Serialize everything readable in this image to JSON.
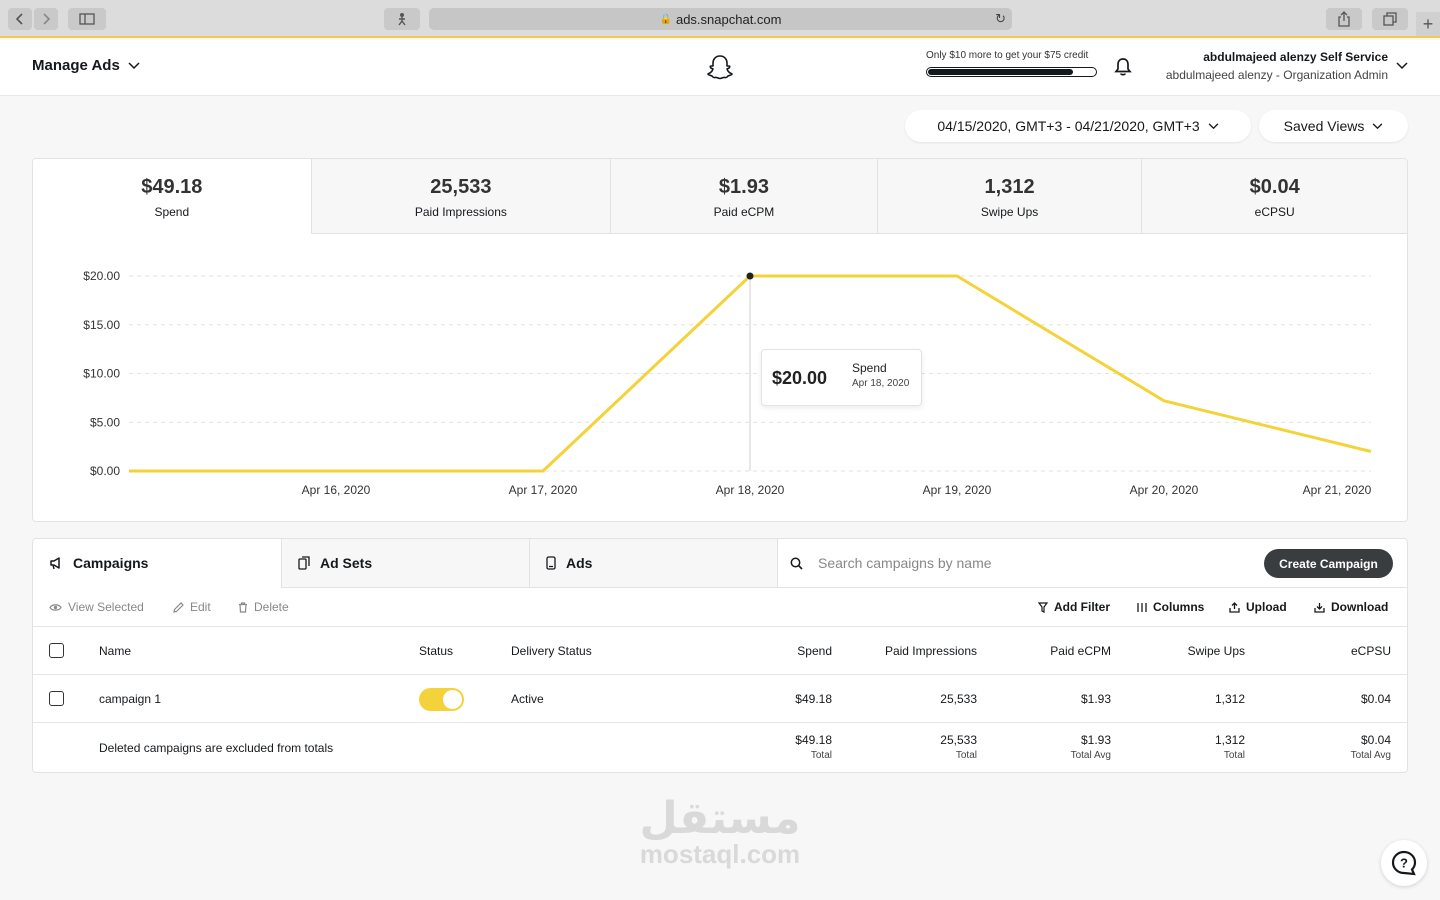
{
  "browser": {
    "url": "ads.snapchat.com",
    "back_icon": "chevron-left-icon",
    "forward_icon": "chevron-right-icon"
  },
  "header": {
    "menu_label": "Manage Ads",
    "credit_text": "Only $10 more to get your $75 credit",
    "credit_progress": 0.87,
    "account_name": "abdulmajeed alenzy Self Service",
    "account_role": "abdulmajeed alenzy - Organization Admin"
  },
  "filters": {
    "date_range": "04/15/2020, GMT+3 - 04/21/2020, GMT+3",
    "saved_views": "Saved Views"
  },
  "metrics": [
    {
      "value": "$49.18",
      "label": "Spend"
    },
    {
      "value": "25,533",
      "label": "Paid Impressions"
    },
    {
      "value": "$1.93",
      "label": "Paid eCPM"
    },
    {
      "value": "1,312",
      "label": "Swipe Ups"
    },
    {
      "value": "$0.04",
      "label": "eCPSU"
    }
  ],
  "tooltip": {
    "value": "$20.00",
    "label": "Spend",
    "date": "Apr 18, 2020"
  },
  "chart_data": {
    "type": "line",
    "x": [
      "Apr 15, 2020",
      "Apr 16, 2020",
      "Apr 17, 2020",
      "Apr 18, 2020",
      "Apr 19, 2020",
      "Apr 20, 2020",
      "Apr 21, 2020"
    ],
    "x_tick_labels": [
      "Apr 16, 2020",
      "Apr 17, 2020",
      "Apr 18, 2020",
      "Apr 19, 2020",
      "Apr 20, 2020",
      "Apr 21, 2020"
    ],
    "series": [
      {
        "values": [
          0,
          0,
          0,
          20.0,
          20.0,
          7.2,
          2.0
        ],
        "color": "#f4d23a"
      }
    ],
    "ylim": [
      0,
      20
    ],
    "y_ticks": [
      0,
      5,
      10,
      15,
      20
    ],
    "y_tick_labels": [
      "$0.00",
      "$5.00",
      "$10.00",
      "$15.00",
      "$20.00"
    ],
    "grid": true,
    "highlighted_point": "Apr 18, 2020"
  },
  "campaigns": {
    "tabs": [
      {
        "label": "Campaigns",
        "icon": "megaphone-icon"
      },
      {
        "label": "Ad Sets",
        "icon": "ad-sets-icon"
      },
      {
        "label": "Ads",
        "icon": "ad-icon"
      }
    ],
    "search_placeholder": "Search campaigns by name",
    "create_label": "Create Campaign",
    "toolbar_left": [
      "View Selected",
      "Edit",
      "Delete"
    ],
    "toolbar_right": [
      "Add Filter",
      "Columns",
      "Upload",
      "Download"
    ],
    "columns": [
      "Name",
      "Status",
      "Delivery Status",
      "Spend",
      "Paid Impressions",
      "Paid eCPM",
      "Swipe Ups",
      "eCPSU"
    ],
    "rows": [
      {
        "name": "campaign 1",
        "status_on": true,
        "delivery": "Active",
        "spend": "$49.18",
        "impressions": "25,533",
        "ecpm": "$1.93",
        "swipe_ups": "1,312",
        "ecpsu": "$0.04"
      }
    ],
    "totals": {
      "note": "Deleted campaigns are excluded from totals",
      "spend": "$49.18",
      "spend_sub": "Total",
      "impressions": "25,533",
      "impressions_sub": "Total",
      "ecpm": "$1.93",
      "ecpm_sub": "Total Avg",
      "swipe_ups": "1,312",
      "swipe_ups_sub": "Total",
      "ecpsu": "$0.04",
      "ecpsu_sub": "Total Avg"
    }
  },
  "watermark": {
    "arabic": "مستقل",
    "latin": "mostaql.com"
  },
  "colors": {
    "accent": "#f4d23a",
    "primary_button": "#3a3d40"
  }
}
